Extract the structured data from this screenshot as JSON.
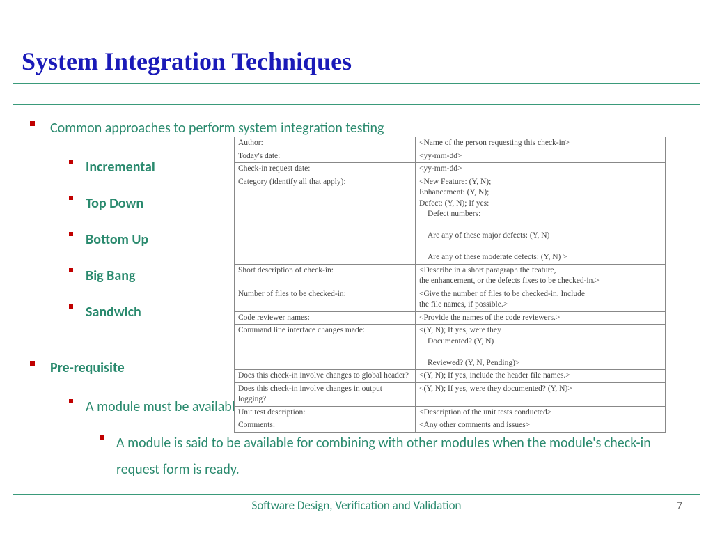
{
  "title": "System Integration Techniques",
  "intro": "Common approaches to perform system integration testing",
  "approaches": [
    "Incremental",
    "Top Down",
    "Bottom Up",
    "Big Bang",
    "Sandwich"
  ],
  "prereq_label": "Pre-requisite",
  "prereq_item": "A module must be available to be integrated",
  "prereq_detail": "A module is said to be available for combining with other modules when the module's check-in request form is ready.",
  "form_rows": [
    {
      "label": "Author:",
      "value": "<Name of the person requesting this check-in>"
    },
    {
      "label": "Today's date:",
      "value": "<yy-mm-dd>"
    },
    {
      "label": "Check-in request date:",
      "value": "<yy-mm-dd>"
    },
    {
      "label": "Category (identify all that apply):",
      "value": "<New Feature: (Y, N);\nEnhancement: (Y, N);\nDefect: (Y, N); If yes:\n  Defect numbers:\n  Are any of these major defects: (Y, N)\n  Are any of these moderate defects: (Y, N) >"
    },
    {
      "label": "Short description of check-in:",
      "value": "<Describe in a short paragraph the feature,\nthe enhancement, or the defects fixes to be checked-in.>"
    },
    {
      "label": "Number of files to be checked-in:",
      "value": "<Give the number of files to be checked-in. Include\nthe file names, if possible.>"
    },
    {
      "label": "Code reviewer names:",
      "value": "<Provide the names of the code reviewers.>"
    },
    {
      "label": "Command line interface changes made:",
      "value": "<(Y, N); If yes, were they\n  Documented? (Y, N)\n  Reviewed? (Y, N, Pending)>"
    },
    {
      "label": "Does this check-in involve changes to global header?",
      "value": "<(Y, N); If yes, include the header file names.>"
    },
    {
      "label": "Does this check-in involve changes in output logging?",
      "value": "<(Y, N); If yes, were they documented? (Y, N)>"
    },
    {
      "label": "Unit test description:",
      "value": "<Description of the unit tests conducted>"
    },
    {
      "label": "Comments:",
      "value": "<Any other comments and issues>"
    }
  ],
  "footer": "Software Design, Verification and Validation",
  "page": "7"
}
